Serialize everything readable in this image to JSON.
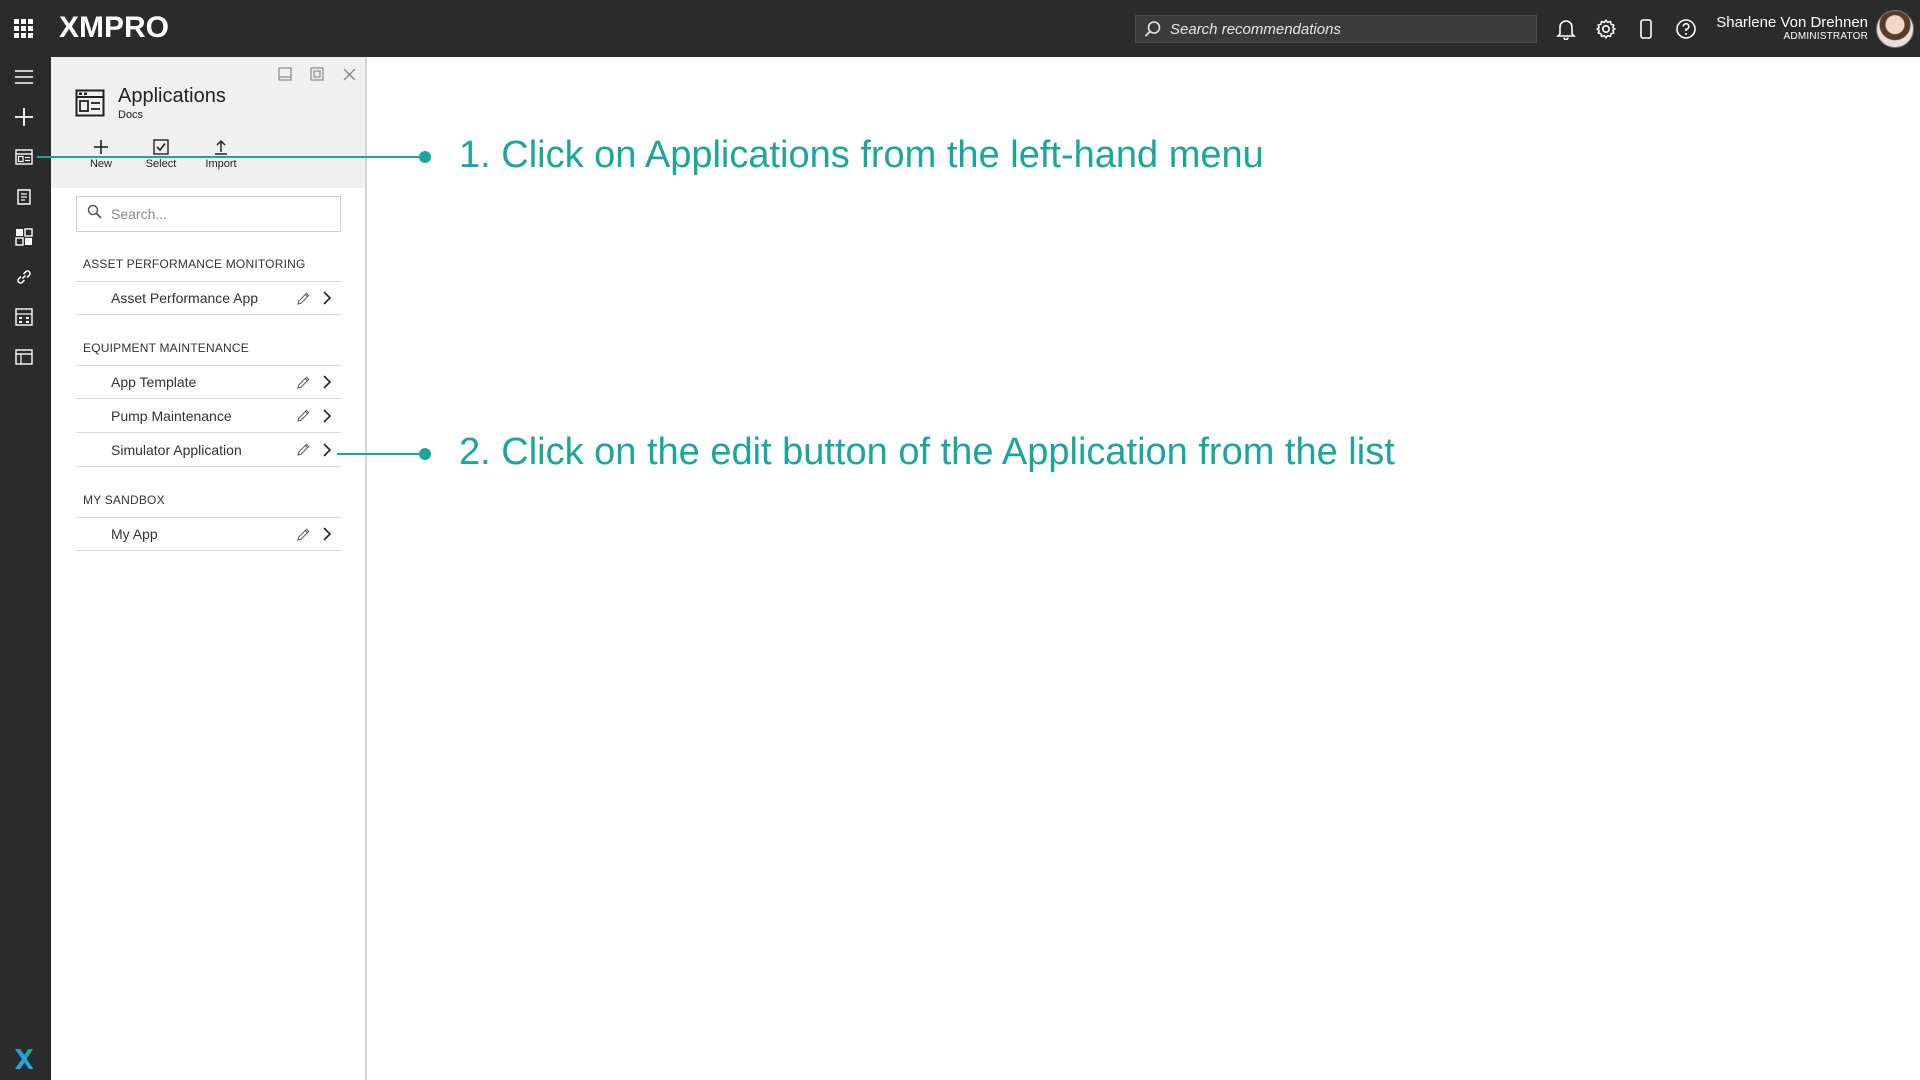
{
  "topbar": {
    "logo": "XMPRO",
    "search_placeholder": "Search recommendations",
    "user_name": "Sharlene Von Drehnen",
    "user_role": "ADMINISTRATOR",
    "icons": [
      "apps-grid-icon",
      "search-icon",
      "bell-icon",
      "gear-icon",
      "mobile-icon",
      "help-icon"
    ]
  },
  "rail": {
    "items": [
      "menu-icon",
      "plus-icon",
      "applications-icon",
      "recommendations-icon",
      "dashboard-icon",
      "link-icon",
      "calculator-icon",
      "calendar-icon"
    ]
  },
  "panel": {
    "title": "Applications",
    "subtitle": "Docs",
    "toolbar": {
      "new": "New",
      "select": "Select",
      "import": "Import"
    },
    "search_placeholder": "Search...",
    "groups": [
      {
        "title": "ASSET PERFORMANCE MONITORING",
        "items": [
          "Asset Performance App"
        ]
      },
      {
        "title": "EQUIPMENT MAINTENANCE",
        "items": [
          "App Template",
          "Pump Maintenance",
          "Simulator Application"
        ]
      },
      {
        "title": "MY SANDBOX",
        "items": [
          "My App"
        ]
      }
    ]
  },
  "annotations": {
    "step1": "1. Click on Applications from the left-hand menu",
    "step2": "2. Click on the edit button of the Application from the list"
  },
  "colors": {
    "accent": "#1aa69b",
    "chrome": "#2b2b2b",
    "panel_header": "#f0f0f0"
  }
}
